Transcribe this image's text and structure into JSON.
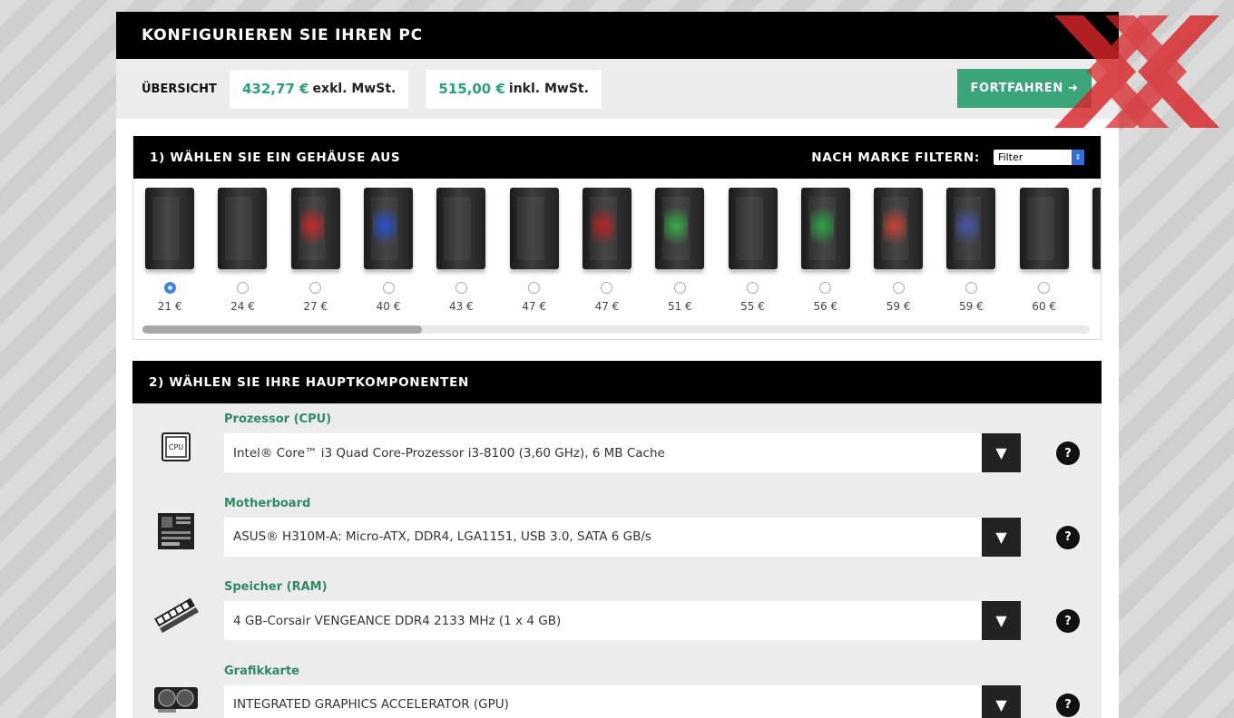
{
  "header": {
    "title": "KONFIGURIEREN SIE IHREN PC"
  },
  "overview": {
    "label": "ÜBERSICHT",
    "net_price": "432,77 €",
    "net_suffix": "exkl. MwSt.",
    "gross_price": "515,00 €",
    "gross_suffix": "inkl. MwSt.",
    "continue_label": "FORTFAHREN ➜"
  },
  "case_section": {
    "title": "1) WÄHLEN SIE EIN GEHÄUSE AUS",
    "filter_label": "NACH MARKE FILTERN:",
    "filter_value": "Filter",
    "cases": [
      {
        "price": "21 €",
        "selected": true,
        "glow": "none"
      },
      {
        "price": "24 €",
        "selected": false,
        "glow": "none"
      },
      {
        "price": "27 €",
        "selected": false,
        "glow": "#c0201c"
      },
      {
        "price": "40 €",
        "selected": false,
        "glow": "#1e48c8"
      },
      {
        "price": "43 €",
        "selected": false,
        "glow": "none"
      },
      {
        "price": "47 €",
        "selected": false,
        "glow": "none"
      },
      {
        "price": "47 €",
        "selected": false,
        "glow": "#b01818"
      },
      {
        "price": "51 €",
        "selected": false,
        "glow": "#2aa83a"
      },
      {
        "price": "55 €",
        "selected": false,
        "glow": "none"
      },
      {
        "price": "56 €",
        "selected": false,
        "glow": "#22a040"
      },
      {
        "price": "59 €",
        "selected": false,
        "glow": "#c33a2a"
      },
      {
        "price": "59 €",
        "selected": false,
        "glow": "#3c4ca0"
      },
      {
        "price": "60 €",
        "selected": false,
        "glow": "none"
      },
      {
        "price": "",
        "selected": false,
        "glow": "none"
      }
    ]
  },
  "components_section": {
    "title": "2) WÄHLEN SIE IHRE HAUPTKOMPONENTEN",
    "items": [
      {
        "title": "Prozessor (CPU)",
        "value": "Intel® Core™ i3 Quad Core-Prozessor i3-8100 (3,60 GHz), 6 MB Cache",
        "icon": "cpu-icon",
        "icon_text": "CPU"
      },
      {
        "title": "Motherboard",
        "value": "ASUS® H310M-A: Micro-ATX, DDR4, LGA1151, USB 3.0, SATA 6 GB/s",
        "icon": "motherboard-icon"
      },
      {
        "title": "Speicher (RAM)",
        "value": "4 GB-Corsair VENGEANCE DDR4 2133 MHz (1 x 4 GB)",
        "icon": "ram-icon"
      },
      {
        "title": "Grafikkarte",
        "value": "INTEGRATED GRAPHICS ACCELERATOR (GPU)",
        "icon": "gpu-icon"
      }
    ],
    "dropdown_glyph": "▼",
    "help_glyph": "?"
  },
  "colors": {
    "accent": "#3aa57a",
    "text_accent": "#2aa07a",
    "logo": "#d8262a"
  }
}
